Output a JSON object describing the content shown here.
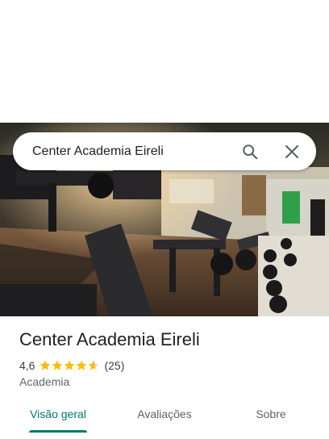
{
  "search": {
    "query": "Center Academia Eireli"
  },
  "icons": {
    "search": "search-icon",
    "close": "close-icon"
  },
  "place": {
    "name": "Center Academia Eireli",
    "rating": "4,6",
    "rating_value": 4.6,
    "stars_max": 5,
    "review_count": "(25)",
    "category": "Academia"
  },
  "tabs": [
    {
      "label": "Visão geral",
      "active": true
    },
    {
      "label": "Avaliações",
      "active": false
    },
    {
      "label": "Sobre",
      "active": false
    }
  ],
  "colors": {
    "accent": "#00796b",
    "star": "#fbbc04",
    "text_primary": "#202124",
    "text_secondary": "#5f6368"
  }
}
